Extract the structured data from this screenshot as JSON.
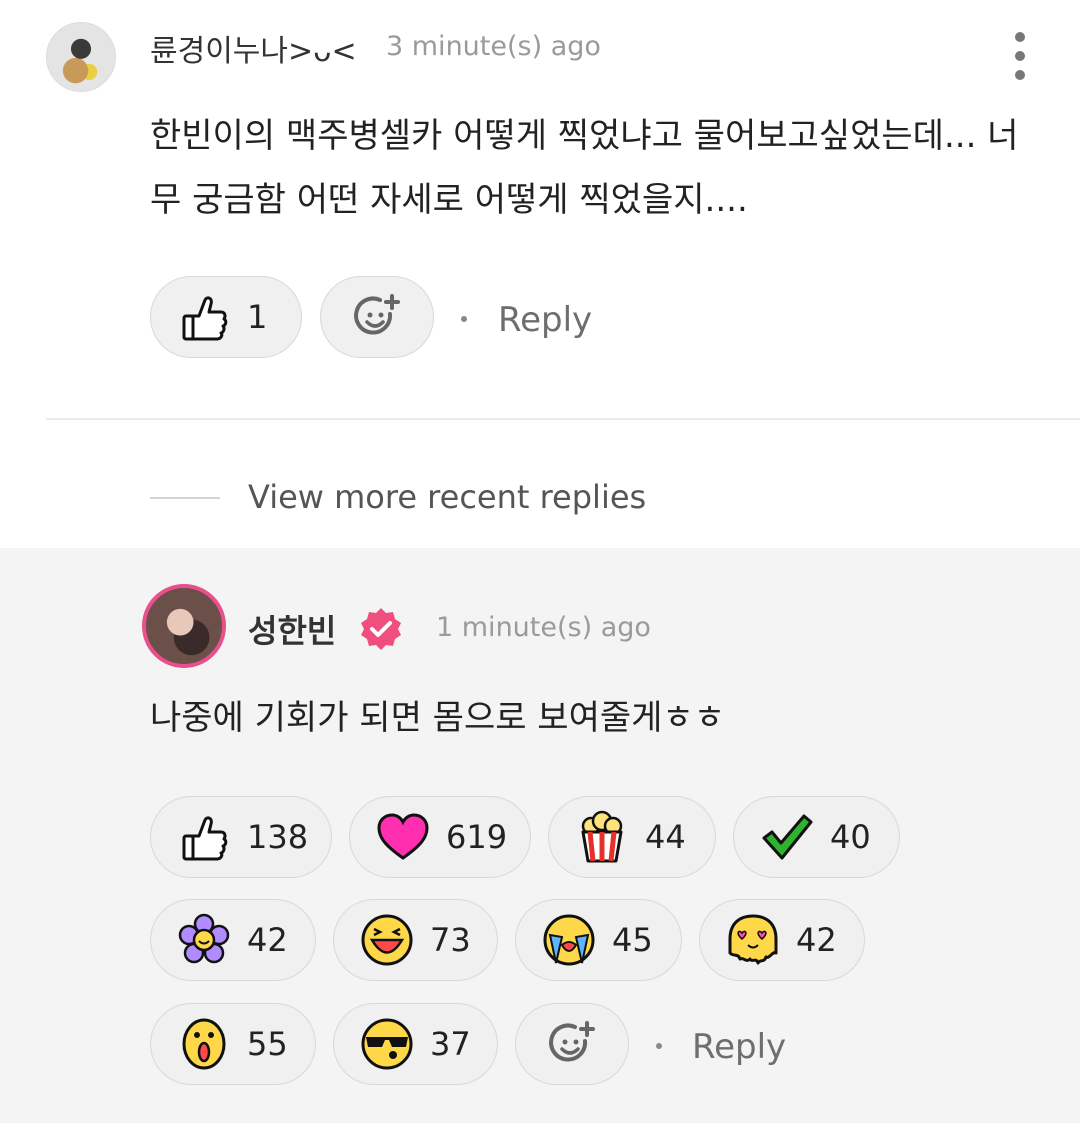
{
  "comment1": {
    "username": "륜경이누나>ᴗ<",
    "time": "3 minute(s) ago",
    "text": "한빈이의 맥주병셀카 어떻게 찍었냐고 물어보고싶었는데... 너무 궁금함 어떤 자세로 어떻게 찍었을지....",
    "like_count": "1",
    "reply_label": "Reply"
  },
  "view_more_label": "View more recent replies",
  "comment2": {
    "username": "성한빈",
    "time": "1 minute(s) ago",
    "text": "나중에 기회가 되면 몸으로 보여줄게ㅎㅎ",
    "reactions": [
      {
        "icon": "thumbs-up-icon",
        "count": "138"
      },
      {
        "icon": "heart-icon",
        "count": "619"
      },
      {
        "icon": "popcorn-icon",
        "count": "44"
      },
      {
        "icon": "checkmark-icon",
        "count": "40"
      },
      {
        "icon": "flower-icon",
        "count": "42"
      },
      {
        "icon": "laughing-face-icon",
        "count": "73"
      },
      {
        "icon": "crying-face-icon",
        "count": "45"
      },
      {
        "icon": "heart-eyes-face-icon",
        "count": "42"
      },
      {
        "icon": "surprised-face-icon",
        "count": "55"
      },
      {
        "icon": "sunglasses-face-icon",
        "count": "37"
      }
    ],
    "reply_label": "Reply"
  },
  "colors": {
    "verified_badge": "#f04e7e",
    "avatar_ring": "#e84f8c",
    "heart": "#ff2fb0",
    "check": "#2db32d"
  }
}
